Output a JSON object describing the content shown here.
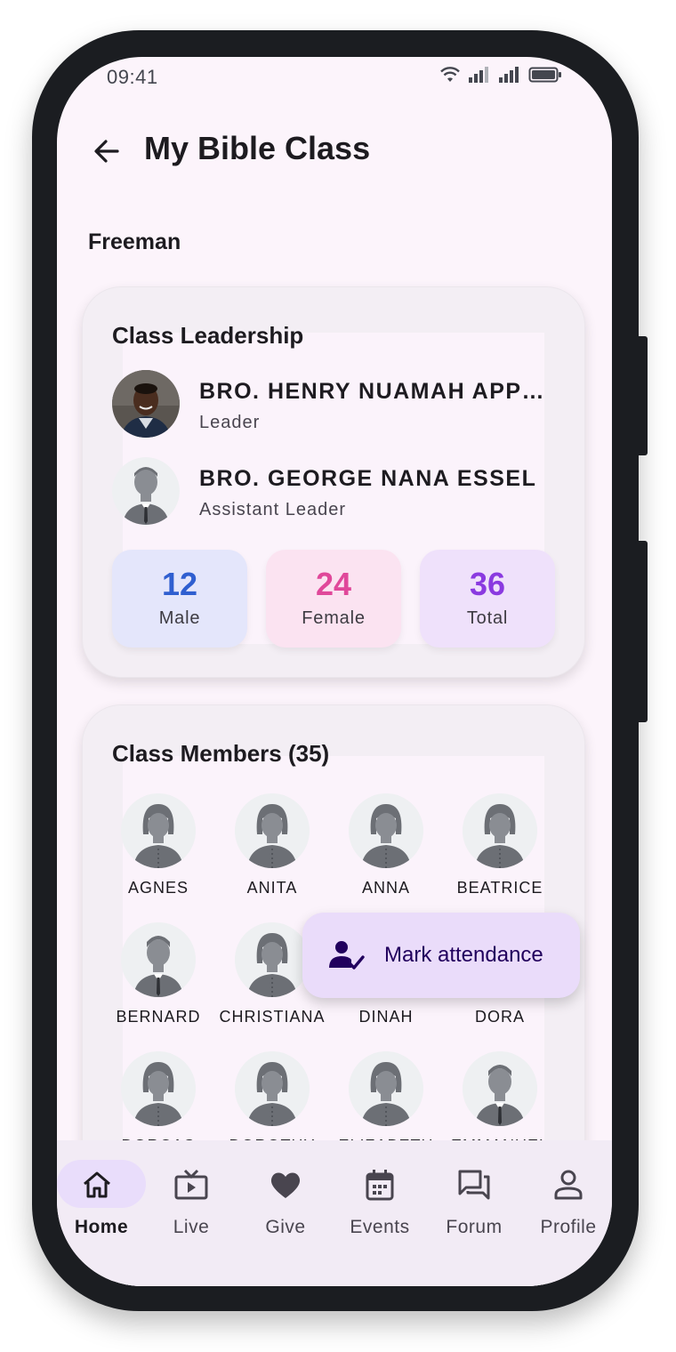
{
  "status": {
    "time": "09:41",
    "icons": [
      "wifi-icon",
      "signal-icon",
      "signal-icon",
      "battery-icon"
    ]
  },
  "appbar": {
    "title": "My Bible Class",
    "back_icon": "arrow-back-icon"
  },
  "class_name": "Freeman",
  "leadership": {
    "title": "Class Leadership",
    "leaders": [
      {
        "name": "BRO. HENRY NUAMAH APPIAH",
        "role": "Leader",
        "avatar": "photo"
      },
      {
        "name": "BRO. GEORGE NANA ESSEL",
        "role": "Assistant Leader",
        "avatar": "male-placeholder"
      }
    ],
    "stats": [
      {
        "value": "12",
        "label": "Male",
        "color": "#2f5fd0",
        "bg": "#e4e6fb"
      },
      {
        "value": "24",
        "label": "Female",
        "color": "#e0489a",
        "bg": "#fbe3f1"
      },
      {
        "value": "36",
        "label": "Total",
        "color": "#8a3ae0",
        "bg": "#efe1fb"
      }
    ]
  },
  "members": {
    "title": "Class Members (35)",
    "items": [
      {
        "name": "AGNES",
        "gender": "female"
      },
      {
        "name": "ANITA",
        "gender": "female"
      },
      {
        "name": "ANNA",
        "gender": "female"
      },
      {
        "name": "BEATRICE",
        "gender": "female"
      },
      {
        "name": "BERNARD",
        "gender": "male"
      },
      {
        "name": "CHRISTIANA",
        "gender": "female"
      },
      {
        "name": "DINAH",
        "gender": "female"
      },
      {
        "name": "DORA",
        "gender": "female"
      },
      {
        "name": "DORCAS",
        "gender": "female"
      },
      {
        "name": "DOROTHY",
        "gender": "female"
      },
      {
        "name": "ELIZABETH",
        "gender": "female"
      },
      {
        "name": "EMMANUEL",
        "gender": "male"
      }
    ]
  },
  "fab": {
    "label": "Mark attendance",
    "icon": "person-check-icon"
  },
  "nav": {
    "items": [
      {
        "label": "Home",
        "icon": "home-icon",
        "active": true
      },
      {
        "label": "Live",
        "icon": "live-tv-icon",
        "active": false
      },
      {
        "label": "Give",
        "icon": "heart-icon",
        "active": false
      },
      {
        "label": "Events",
        "icon": "calendar-icon",
        "active": false
      },
      {
        "label": "Forum",
        "icon": "forum-icon",
        "active": false
      },
      {
        "label": "Profile",
        "icon": "person-icon",
        "active": false
      }
    ]
  }
}
